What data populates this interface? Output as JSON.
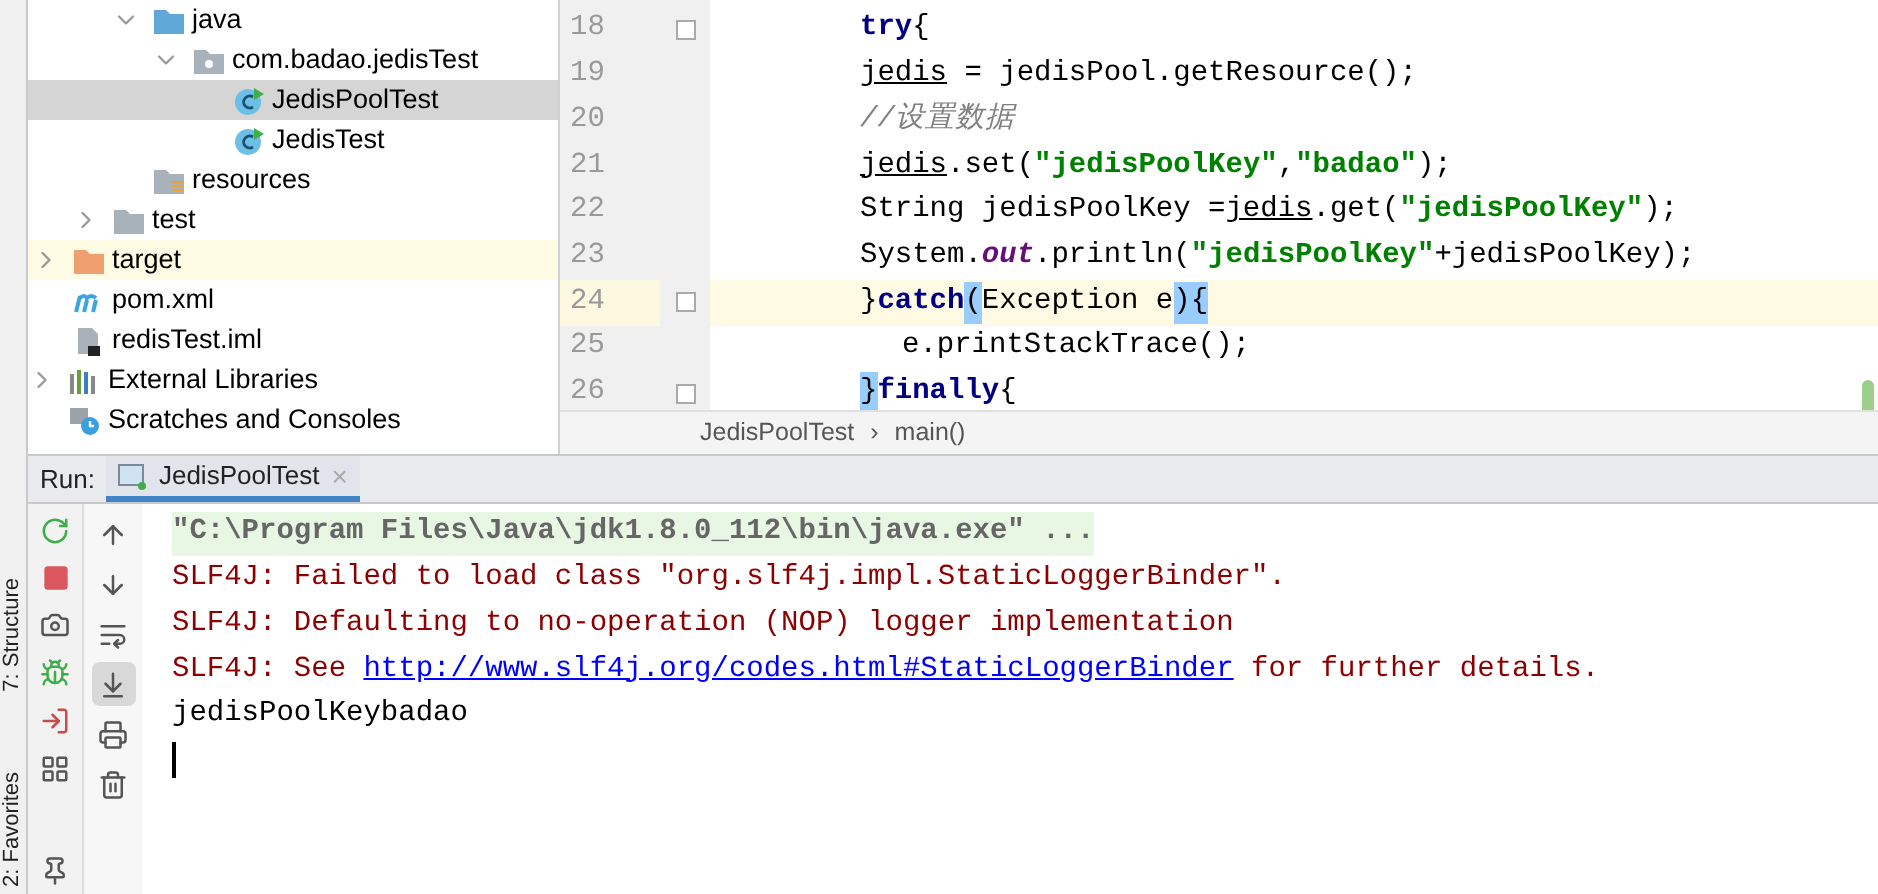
{
  "tree": [
    {
      "children": [
        {
          "children": [
            {
              "children": [
                {
                  "label": "java",
                  "kind": "source-folder",
                  "expanded": true,
                  "selected": false,
                  "hovered": false,
                  "children": [
                    {
                      "label": "com.badao.jedisTest",
                      "kind": "package",
                      "expanded": true,
                      "selected": false,
                      "hovered": false,
                      "children": [
                        {
                          "label": "JedisPoolTest",
                          "kind": "class",
                          "selected": true,
                          "hovered": false
                        },
                        {
                          "label": "JedisTest",
                          "kind": "class",
                          "selected": false,
                          "hovered": false
                        }
                      ]
                    }
                  ]
                },
                {
                  "label": "resources",
                  "kind": "resources",
                  "selected": false,
                  "hovered": false
                }
              ]
            },
            {
              "label": "test",
              "kind": "folder",
              "expanded": false,
              "selected": false,
              "hovered": false
            }
          ]
        },
        {
          "label": "target",
          "kind": "excluded-folder",
          "expanded": false,
          "selected": false,
          "hovered": true
        },
        {
          "label": "pom.xml",
          "kind": "maven",
          "selected": false,
          "hovered": false
        },
        {
          "label": "redisTest.iml",
          "kind": "module-file",
          "selected": false,
          "hovered": false
        }
      ]
    },
    {
      "label": "External Libraries",
      "kind": "libraries",
      "expanded": false,
      "selected": false,
      "hovered": false
    },
    {
      "label": "Scratches and Consoles",
      "kind": "scratches",
      "selected": false,
      "hovered": false
    }
  ],
  "editor": {
    "lines": [
      {
        "number": "18",
        "current": false,
        "fold": true,
        "indent": false,
        "tokens": [
          {
            "text": "try",
            "kind": "keyword"
          },
          {
            "text": "{",
            "kind": "plain"
          }
        ]
      },
      {
        "number": "19",
        "current": false,
        "fold": false,
        "indent": false,
        "tokens": [
          {
            "text": "jedis",
            "kind": "var"
          },
          {
            "text": " = jedisPool.getResource();",
            "kind": "plain"
          }
        ]
      },
      {
        "number": "20",
        "current": false,
        "fold": false,
        "indent": false,
        "tokens": [
          {
            "text": "//设置数据",
            "kind": "comment"
          }
        ]
      },
      {
        "number": "21",
        "current": false,
        "fold": false,
        "indent": false,
        "tokens": [
          {
            "text": "jedis",
            "kind": "var"
          },
          {
            "text": ".set(",
            "kind": "plain"
          },
          {
            "text": "\"jedisPoolKey\"",
            "kind": "string"
          },
          {
            "text": ",",
            "kind": "plain"
          },
          {
            "text": "\"badao\"",
            "kind": "string"
          },
          {
            "text": ");",
            "kind": "plain"
          }
        ]
      },
      {
        "number": "22",
        "current": false,
        "fold": false,
        "indent": false,
        "tokens": [
          {
            "text": "String jedisPoolKey =",
            "kind": "plain"
          },
          {
            "text": "jedis",
            "kind": "var"
          },
          {
            "text": ".get(",
            "kind": "plain"
          },
          {
            "text": "\"jedisPoolKey\"",
            "kind": "string"
          },
          {
            "text": ");",
            "kind": "plain"
          }
        ]
      },
      {
        "number": "23",
        "current": false,
        "fold": false,
        "indent": false,
        "tokens": [
          {
            "text": "System.",
            "kind": "plain"
          },
          {
            "text": "out",
            "kind": "field"
          },
          {
            "text": ".println(",
            "kind": "plain"
          },
          {
            "text": "\"jedisPoolKey\"",
            "kind": "string"
          },
          {
            "text": "+jedisPoolKey);",
            "kind": "plain"
          }
        ]
      },
      {
        "number": "24",
        "current": true,
        "fold": true,
        "indent": false,
        "tokens": [
          {
            "text": "}",
            "kind": "plain"
          },
          {
            "text": "catch",
            "kind": "keyword"
          },
          {
            "text": "(",
            "kind": "brace"
          },
          {
            "text": "Exception e",
            "kind": "plain"
          },
          {
            "text": ")",
            "kind": "brace"
          },
          {
            "text": "{",
            "kind": "brace"
          }
        ]
      },
      {
        "number": "25",
        "current": false,
        "fold": false,
        "indent": true,
        "tokens": [
          {
            "text": "e.printStackTrace();",
            "kind": "plain"
          }
        ]
      },
      {
        "number": "26",
        "current": false,
        "fold": true,
        "indent": false,
        "tokens": [
          {
            "text": "}",
            "kind": "brace"
          },
          {
            "text": "finally",
            "kind": "keyword"
          },
          {
            "text": "{",
            "kind": "plain"
          }
        ]
      }
    ],
    "breadcrumbs": [
      "JedisPoolTest",
      "›",
      "main()"
    ]
  },
  "side_strip": [
    "7: Structure",
    "2: Favorites"
  ],
  "run": {
    "label": "Run:",
    "tabs": [
      {
        "label": "JedisPoolTest",
        "close": "×",
        "selected": true
      }
    ]
  },
  "console_toolbar": [
    {
      "kind": "up",
      "selected": false
    },
    {
      "kind": "down",
      "selected": false
    },
    {
      "kind": "wrap",
      "selected": false
    },
    {
      "kind": "scroll-end",
      "selected": true
    },
    {
      "kind": "print",
      "selected": false
    },
    {
      "kind": "trash",
      "selected": false
    }
  ],
  "console": {
    "caret": true,
    "lines": [
      {
        "kind": "command",
        "parts": [
          {
            "text": "\"C:\\Program Files\\Java\\jdk1.8.0_112\\bin\\java.exe\" ...",
            "kind": "text"
          }
        ]
      },
      {
        "kind": "error",
        "parts": [
          {
            "text": "SLF4J: Failed to load class \"org.slf4j.impl.StaticLoggerBinder\".",
            "kind": "text"
          }
        ]
      },
      {
        "kind": "error",
        "parts": [
          {
            "text": "SLF4J: Defaulting to no-operation (NOP) logger implementation",
            "kind": "text"
          }
        ]
      },
      {
        "kind": "error",
        "parts": [
          {
            "text": "SLF4J: See ",
            "kind": "text"
          },
          {
            "text": "http://www.slf4j.org/codes.html#StaticLoggerBinder",
            "kind": "link"
          },
          {
            "text": " for further details.",
            "kind": "text"
          }
        ]
      },
      {
        "kind": "output",
        "parts": [
          {
            "text": "jedisPoolKeybadao",
            "kind": "text"
          }
        ]
      }
    ]
  }
}
